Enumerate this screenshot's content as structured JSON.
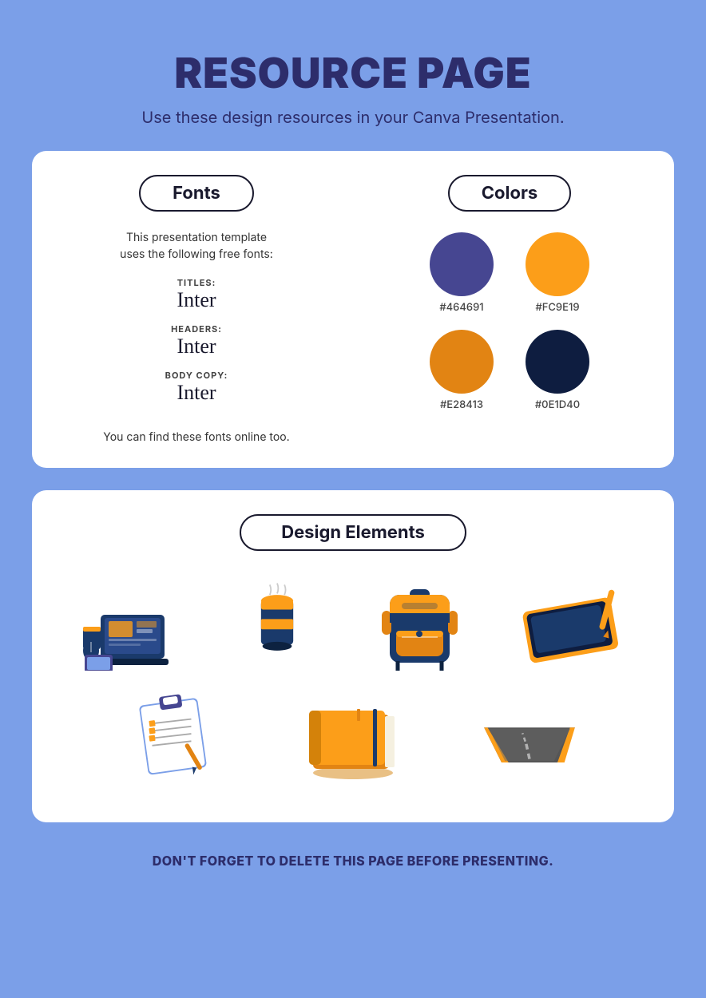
{
  "header": {
    "title": "RESOURCE PAGE",
    "subtitle": "Use these design resources in your Canva Presentation."
  },
  "fonts_section": {
    "tab_label": "Fonts",
    "intro": "This presentation template\nuses the following free fonts:",
    "entries": [
      {
        "label": "TITLES:",
        "name": "Inter"
      },
      {
        "label": "HEADERS:",
        "name": "Inter"
      },
      {
        "label": "BODY COPY:",
        "name": "Inter"
      }
    ],
    "footer": "You can find these fonts online too."
  },
  "colors_section": {
    "tab_label": "Colors",
    "colors": [
      {
        "hex": "#464691",
        "label": "#464691"
      },
      {
        "hex": "#FC9E19",
        "label": "#FC9E19"
      },
      {
        "hex": "#E28413",
        "label": "#E28413"
      },
      {
        "hex": "#0E1D40",
        "label": "#0E1D40"
      }
    ]
  },
  "design_elements": {
    "tab_label": "Design Elements"
  },
  "footer": {
    "note": "DON'T FORGET TO DELETE THIS PAGE BEFORE PRESENTING."
  }
}
